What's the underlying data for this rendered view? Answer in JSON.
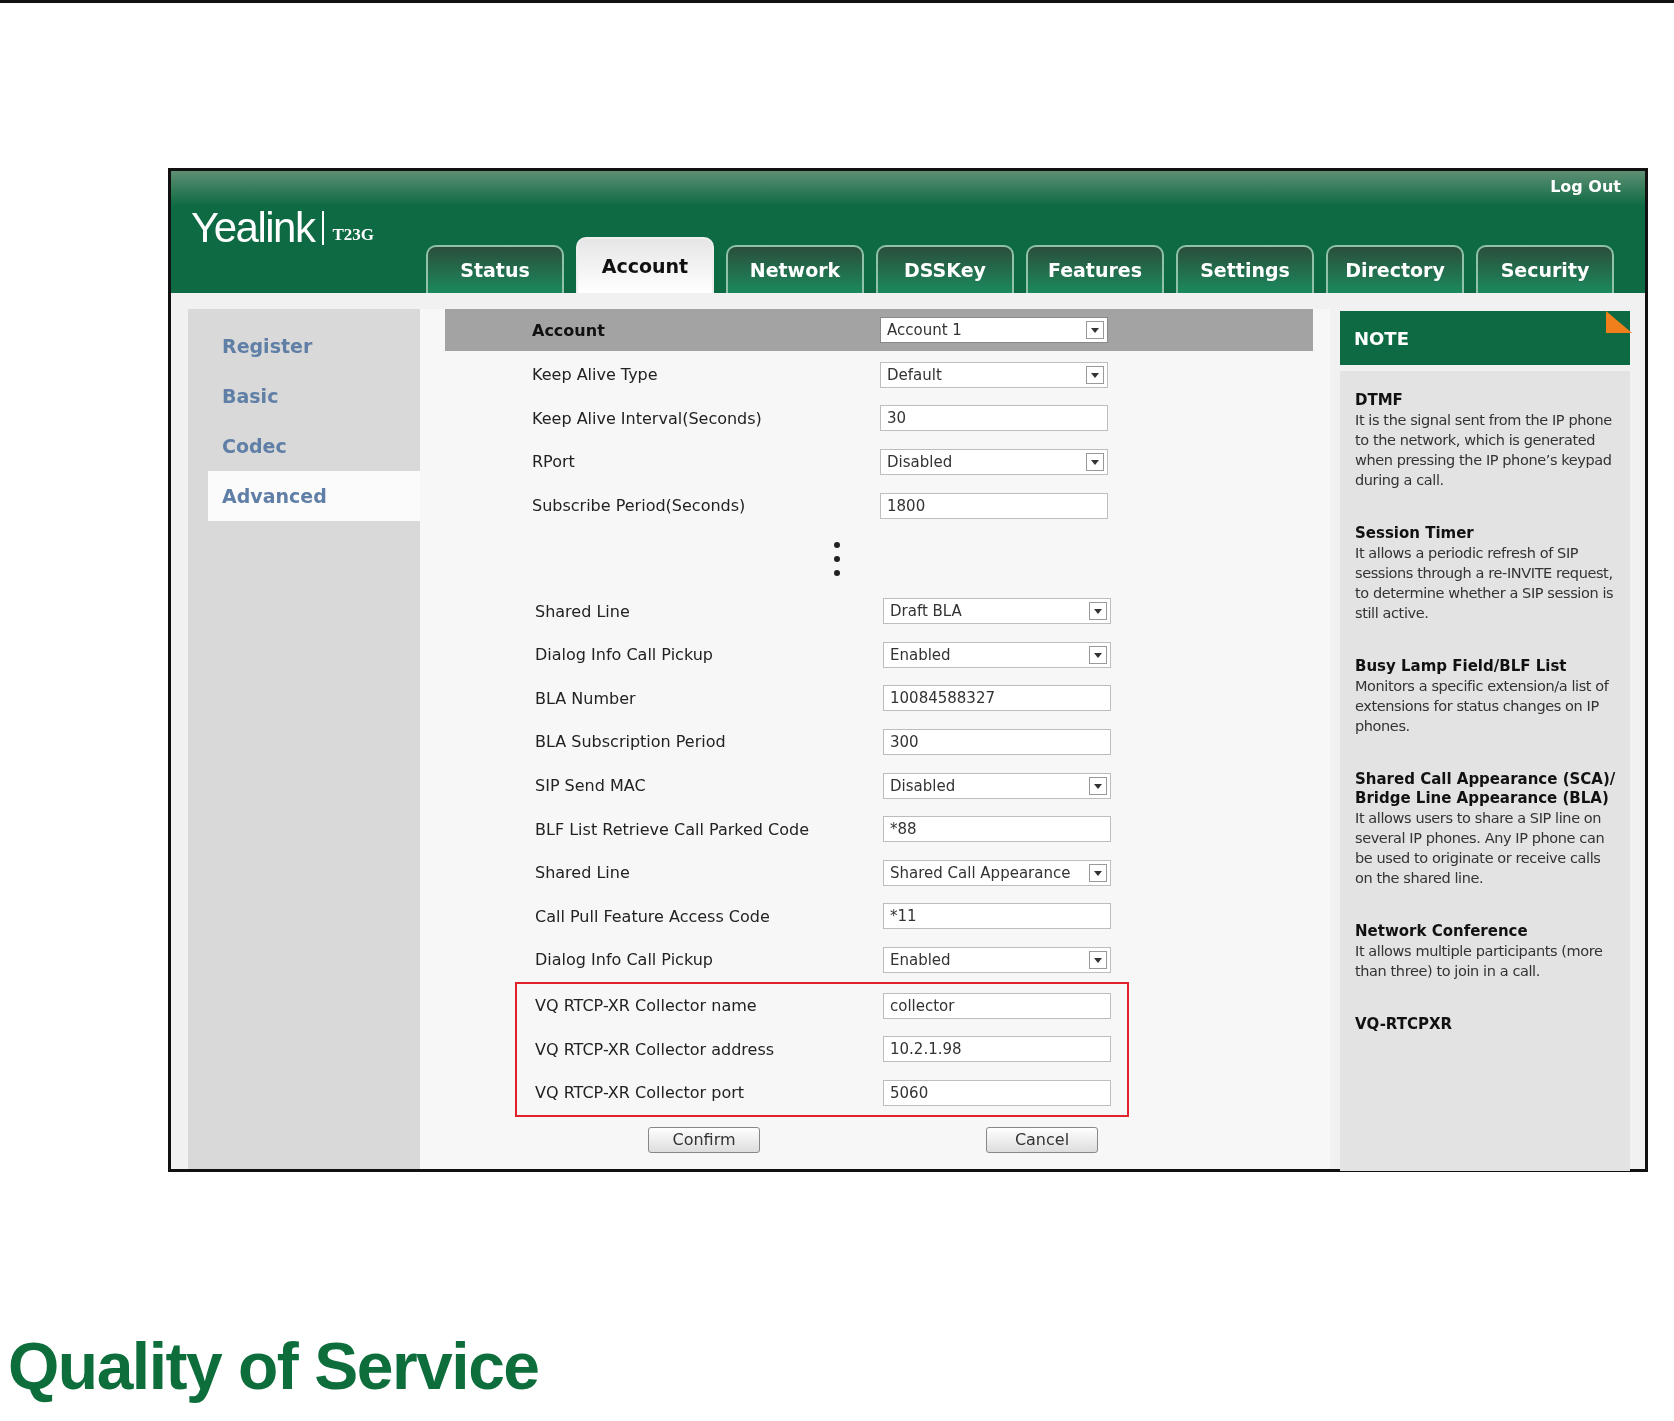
{
  "header": {
    "brand": "Yealink",
    "model": "T23G",
    "logout": "Log Out"
  },
  "tabs": [
    {
      "label": "Status",
      "selected": false
    },
    {
      "label": "Account",
      "selected": true
    },
    {
      "label": "Network",
      "selected": false
    },
    {
      "label": "DSSKey",
      "selected": false
    },
    {
      "label": "Features",
      "selected": false
    },
    {
      "label": "Settings",
      "selected": false
    },
    {
      "label": "Directory",
      "selected": false
    },
    {
      "label": "Security",
      "selected": false
    }
  ],
  "sidebar": {
    "items": [
      {
        "label": "Register",
        "selected": false
      },
      {
        "label": "Basic",
        "selected": false
      },
      {
        "label": "Codec",
        "selected": false
      },
      {
        "label": "Advanced",
        "selected": true
      }
    ]
  },
  "form": {
    "header": {
      "label": "Account",
      "value": "Account 1"
    },
    "rows": [
      {
        "label": "Keep Alive Type",
        "kind": "select",
        "value": "Default"
      },
      {
        "label": "Keep Alive Interval(Seconds)",
        "kind": "text",
        "value": "30"
      },
      {
        "label": "RPort",
        "kind": "select",
        "value": "Disabled"
      },
      {
        "label": "Subscribe Period(Seconds)",
        "kind": "text",
        "value": "1800"
      }
    ],
    "more_rows": [
      {
        "label": "Shared Line",
        "kind": "select",
        "value": "Draft BLA"
      },
      {
        "label": "Dialog Info Call Pickup",
        "kind": "select",
        "value": "Enabled"
      },
      {
        "label": "BLA Number",
        "kind": "text",
        "value": "10084588327"
      },
      {
        "label": "BLA Subscription Period",
        "kind": "text",
        "value": "300"
      },
      {
        "label": "SIP Send MAC",
        "kind": "select",
        "value": "Disabled"
      },
      {
        "label": "BLF List Retrieve Call Parked Code",
        "kind": "text",
        "value": "*88"
      },
      {
        "label": "Shared Line",
        "kind": "select",
        "value": "Shared Call Appearance"
      },
      {
        "label": "Call Pull Feature Access Code",
        "kind": "text",
        "value": "*11"
      },
      {
        "label": "Dialog Info Call Pickup",
        "kind": "select",
        "value": "Enabled"
      }
    ],
    "highlighted_rows": [
      {
        "label": "VQ RTCP-XR Collector name",
        "kind": "text",
        "value": "collector"
      },
      {
        "label": "VQ RTCP-XR Collector address",
        "kind": "text",
        "value": "10.2.1.98"
      },
      {
        "label": "VQ RTCP-XR Collector port",
        "kind": "text",
        "value": "5060"
      }
    ],
    "buttons": [
      "Confirm",
      "Cancel"
    ]
  },
  "note": {
    "title": "NOTE",
    "entries": [
      {
        "title": "DTMF",
        "text": "It is the signal sent from the IP phone to the network, which is generated when pressing the IP phone’s keypad during a call."
      },
      {
        "title": "Session Timer",
        "text": "It allows a periodic refresh of SIP sessions through a re-INVITE request, to determine whether a SIP session is still active."
      },
      {
        "title": "Busy Lamp Field/BLF List",
        "text": "Monitors a specific extension/a list of extensions for status changes on IP phones."
      },
      {
        "title": "Shared Call Appearance (SCA)/ Bridge Line Appearance (BLA)",
        "text": "It allows users to share a SIP line on several IP phones. Any IP phone can be used to originate or receive calls on the shared line."
      },
      {
        "title": "Network Conference",
        "text": "It allows multiple participants (more than three) to join in a call."
      },
      {
        "title": "VQ-RTCPXR"
      }
    ]
  },
  "section_title": "Quality of Service"
}
